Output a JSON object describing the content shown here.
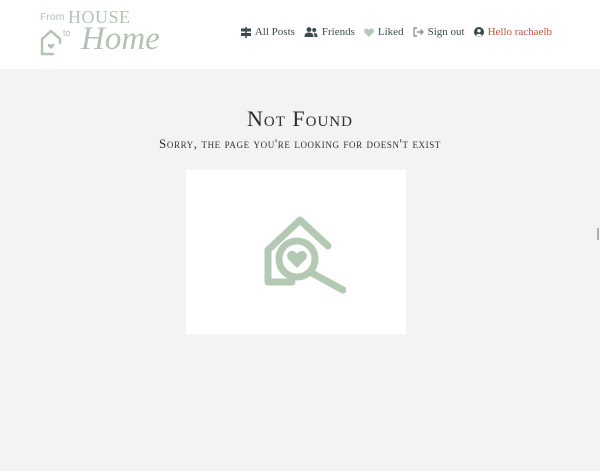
{
  "brand": {
    "from": "From",
    "house": "HOUSE",
    "to": "to",
    "home": "Home"
  },
  "nav": {
    "items": [
      {
        "label": "All Posts",
        "icon": "signpost-icon"
      },
      {
        "label": "Friends",
        "icon": "users-icon"
      },
      {
        "label": "Liked",
        "icon": "heart-icon"
      },
      {
        "label": "Sign out",
        "icon": "sign-out-icon"
      },
      {
        "label": "Hello rachaelb",
        "icon": "user-circle-icon"
      }
    ]
  },
  "main": {
    "title": "Not Found",
    "subtitle": "Sorry, the page you're looking for doesn't exist",
    "image_icon": "house-search-icon"
  },
  "colors": {
    "accent_green": "#b3c9b3",
    "hello_red": "#c0543c",
    "text_dark": "#2b2f32"
  }
}
